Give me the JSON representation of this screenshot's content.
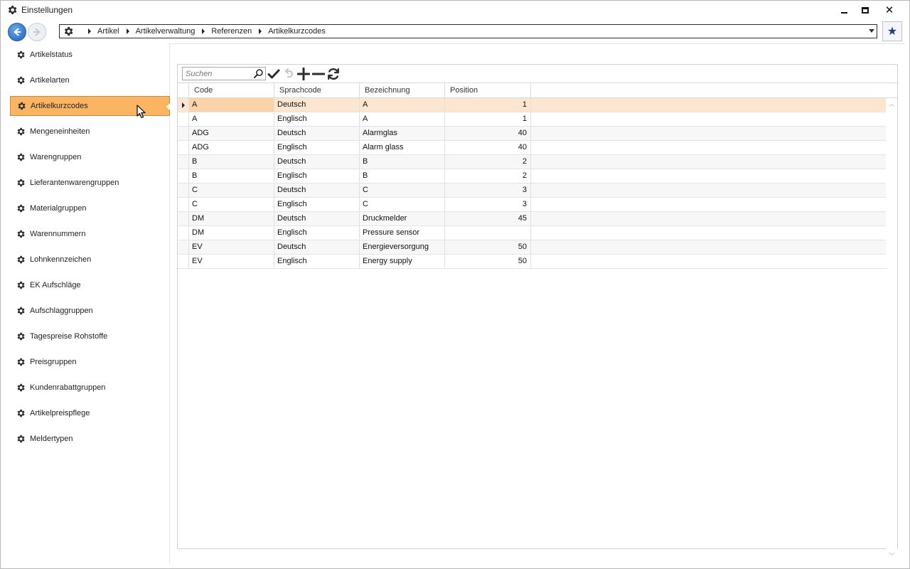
{
  "window": {
    "title": "Einstellungen",
    "controls": {
      "minimize": "minimize",
      "maximize": "maximize",
      "close": "✕"
    }
  },
  "navbar": {
    "breadcrumb": [
      "Artikel",
      "Artikelverwaltung",
      "Referenzen",
      "Artikelkurzcodes"
    ],
    "favorite_icon": "★"
  },
  "sidebar": {
    "items": [
      {
        "label": "Artikelstatus"
      },
      {
        "label": "Artikelarten"
      },
      {
        "label": "Artikelkurzcodes",
        "active": true
      },
      {
        "label": "Mengeneinheiten"
      },
      {
        "label": "Warengruppen"
      },
      {
        "label": "Lieferantenwarengruppen"
      },
      {
        "label": "Materialgruppen"
      },
      {
        "label": "Warennummern"
      },
      {
        "label": "Lohnkennzeichen"
      },
      {
        "label": "EK Aufschläge"
      },
      {
        "label": "Aufschlaggruppen"
      },
      {
        "label": "Tagespreise Rohstoffe"
      },
      {
        "label": "Preisgruppen"
      },
      {
        "label": "Kundenrabattgruppen"
      },
      {
        "label": "Artikelpreispflege"
      },
      {
        "label": "Meldertypen"
      }
    ]
  },
  "toolbar": {
    "search_placeholder": "Suchen",
    "buttons": [
      "check-icon",
      "undo-icon",
      "add-icon",
      "remove-icon",
      "refresh-icon"
    ]
  },
  "grid": {
    "columns": [
      "Code",
      "Sprachcode",
      "Bezeichnung",
      "Position"
    ],
    "rows": [
      {
        "code": "A",
        "lang": "Deutsch",
        "desc": "A",
        "pos": "1",
        "selected": true
      },
      {
        "code": "A",
        "lang": "Englisch",
        "desc": "A",
        "pos": "1"
      },
      {
        "code": "ADG",
        "lang": "Deutsch",
        "desc": "Alarmglas",
        "pos": "40"
      },
      {
        "code": "ADG",
        "lang": "Englisch",
        "desc": "Alarm glass",
        "pos": "40"
      },
      {
        "code": "B",
        "lang": "Deutsch",
        "desc": "B",
        "pos": "2"
      },
      {
        "code": "B",
        "lang": "Englisch",
        "desc": "B",
        "pos": "2"
      },
      {
        "code": "C",
        "lang": "Deutsch",
        "desc": "C",
        "pos": "3"
      },
      {
        "code": "C",
        "lang": "Englisch",
        "desc": "C",
        "pos": "3"
      },
      {
        "code": "DM",
        "lang": "Deutsch",
        "desc": "Druckmelder",
        "pos": "45"
      },
      {
        "code": "DM",
        "lang": "Englisch",
        "desc": "Pressure sensor",
        "pos": ""
      },
      {
        "code": "EV",
        "lang": "Deutsch",
        "desc": "Energieversorgung",
        "pos": "50"
      },
      {
        "code": "EV",
        "lang": "Englisch",
        "desc": "Energy supply",
        "pos": "50"
      }
    ]
  },
  "colors": {
    "accent_active": "#fbb562",
    "selected_row": "#fde6cf",
    "back_button": "#1f5fb8"
  }
}
